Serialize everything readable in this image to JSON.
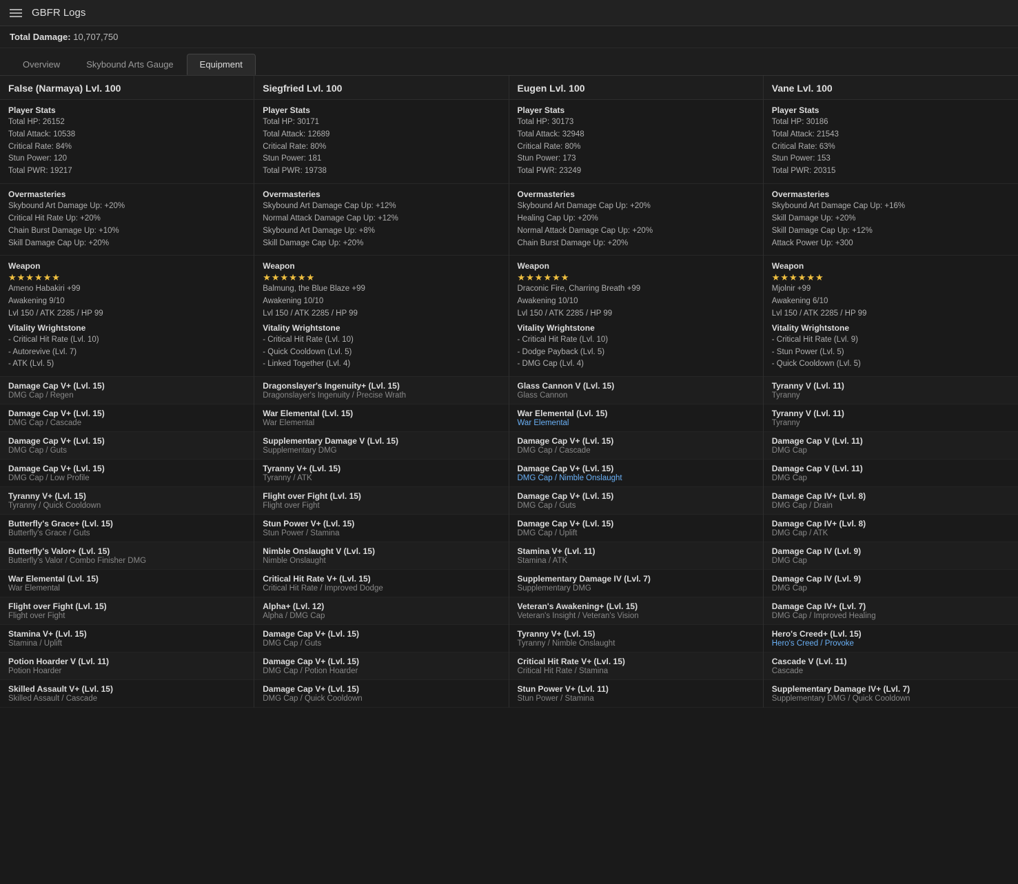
{
  "header": {
    "menu_icon_label": "Menu",
    "title": "GBFR Logs"
  },
  "total_damage": {
    "label": "Total Damage:",
    "value": "10,707,750"
  },
  "tabs": [
    {
      "label": "Overview",
      "active": false
    },
    {
      "label": "Skybound Arts Gauge",
      "active": false
    },
    {
      "label": "Equipment",
      "active": true
    }
  ],
  "columns": [
    {
      "header": "False (Narmaya) Lvl. 100",
      "player_stats": {
        "title": "Player Stats",
        "lines": [
          "Total HP: 26152",
          "Total Attack: 10538",
          "Critical Rate: 84%",
          "Stun Power: 120",
          "Total PWR: 19217"
        ]
      },
      "overmasteries": {
        "title": "Overmasteries",
        "lines": [
          "Skybound Art Damage Up: +20%",
          "Critical Hit Rate Up: +20%",
          "Chain Burst Damage Up: +10%",
          "Skill Damage Cap Up: +20%"
        ]
      },
      "weapon": {
        "title": "Weapon",
        "stars": "★★★★★★",
        "lines": [
          "Ameno Habakiri +99",
          "Awakening 9/10",
          "Lvl 150 / ATK 2285 / HP 99"
        ],
        "wrightstone_title": "Vitality Wrightstone",
        "wrightstone_lines": [
          "- Critical Hit Rate (Lvl. 10)",
          "- Autorevive (Lvl. 7)",
          "- ATK (Lvl. 5)"
        ]
      },
      "skills": [
        {
          "name": "Damage Cap V+ (Lvl. 15)",
          "sub": "DMG Cap / Regen",
          "highlight": false
        },
        {
          "name": "Damage Cap V+ (Lvl. 15)",
          "sub": "DMG Cap / Cascade",
          "highlight": false
        },
        {
          "name": "Damage Cap V+ (Lvl. 15)",
          "sub": "DMG Cap / Guts",
          "highlight": false
        },
        {
          "name": "Damage Cap V+ (Lvl. 15)",
          "sub": "DMG Cap / Low Profile",
          "highlight": false
        },
        {
          "name": "Tyranny V+ (Lvl. 15)",
          "sub": "Tyranny / Quick Cooldown",
          "highlight": false
        },
        {
          "name": "Butterfly's Grace+ (Lvl. 15)",
          "sub": "Butterfly's Grace / Guts",
          "highlight": false
        },
        {
          "name": "Butterfly's Valor+ (Lvl. 15)",
          "sub": "Butterfly's Valor / Combo Finisher DMG",
          "highlight": false
        },
        {
          "name": "War Elemental (Lvl. 15)",
          "sub": "War Elemental",
          "highlight": false
        },
        {
          "name": "Flight over Fight (Lvl. 15)",
          "sub": "Flight over Fight",
          "highlight": false
        },
        {
          "name": "Stamina V+ (Lvl. 15)",
          "sub": "Stamina / Uplift",
          "highlight": false
        },
        {
          "name": "Potion Hoarder V (Lvl. 11)",
          "sub": "Potion Hoarder",
          "highlight": false
        },
        {
          "name": "Skilled Assault V+ (Lvl. 15)",
          "sub": "Skilled Assault / Cascade",
          "highlight": false
        }
      ]
    },
    {
      "header": "Siegfried Lvl. 100",
      "player_stats": {
        "title": "Player Stats",
        "lines": [
          "Total HP: 30171",
          "Total Attack: 12689",
          "Critical Rate: 80%",
          "Stun Power: 181",
          "Total PWR: 19738"
        ]
      },
      "overmasteries": {
        "title": "Overmasteries",
        "lines": [
          "Skybound Art Damage Cap Up: +12%",
          "Normal Attack Damage Cap Up: +12%",
          "Skybound Art Damage Up: +8%",
          "Skill Damage Cap Up: +20%"
        ]
      },
      "weapon": {
        "title": "Weapon",
        "stars": "★★★★★★",
        "lines": [
          "Balmung, the Blue Blaze +99",
          "Awakening 10/10",
          "Lvl 150 / ATK 2285 / HP 99"
        ],
        "wrightstone_title": "Vitality Wrightstone",
        "wrightstone_lines": [
          "- Critical Hit Rate (Lvl. 10)",
          "- Quick Cooldown (Lvl. 5)",
          "- Linked Together (Lvl. 4)"
        ]
      },
      "skills": [
        {
          "name": "Dragonslayer's Ingenuity+ (Lvl. 15)",
          "sub": "Dragonslayer's Ingenuity / Precise Wrath",
          "highlight": false
        },
        {
          "name": "War Elemental (Lvl. 15)",
          "sub": "War Elemental",
          "highlight": false
        },
        {
          "name": "Supplementary Damage V (Lvl. 15)",
          "sub": "Supplementary DMG",
          "highlight": false
        },
        {
          "name": "Tyranny V+ (Lvl. 15)",
          "sub": "Tyranny / ATK",
          "highlight": false
        },
        {
          "name": "Flight over Fight (Lvl. 15)",
          "sub": "Flight over Fight",
          "highlight": false
        },
        {
          "name": "Stun Power V+ (Lvl. 15)",
          "sub": "Stun Power / Stamina",
          "highlight": false
        },
        {
          "name": "Nimble Onslaught V (Lvl. 15)",
          "sub": "Nimble Onslaught",
          "highlight": false
        },
        {
          "name": "Critical Hit Rate V+ (Lvl. 15)",
          "sub": "Critical Hit Rate / Improved Dodge",
          "highlight": false
        },
        {
          "name": "Alpha+ (Lvl. 12)",
          "sub": "Alpha / DMG Cap",
          "highlight": false
        },
        {
          "name": "Damage Cap V+ (Lvl. 15)",
          "sub": "DMG Cap / Guts",
          "highlight": false
        },
        {
          "name": "Damage Cap V+ (Lvl. 15)",
          "sub": "DMG Cap / Potion Hoarder",
          "highlight": false
        },
        {
          "name": "Damage Cap V+ (Lvl. 15)",
          "sub": "DMG Cap / Quick Cooldown",
          "highlight": false
        }
      ]
    },
    {
      "header": "Eugen Lvl. 100",
      "player_stats": {
        "title": "Player Stats",
        "lines": [
          "Total HP: 30173",
          "Total Attack: 32948",
          "Critical Rate: 80%",
          "Stun Power: 173",
          "Total PWR: 23249"
        ]
      },
      "overmasteries": {
        "title": "Overmasteries",
        "lines": [
          "Skybound Art Damage Cap Up: +20%",
          "Healing Cap Up: +20%",
          "Normal Attack Damage Cap Up: +20%",
          "Chain Burst Damage Up: +20%"
        ]
      },
      "weapon": {
        "title": "Weapon",
        "stars": "★★★★★★",
        "lines": [
          "Draconic Fire, Charring Breath +99",
          "Awakening 10/10",
          "Lvl 150 / ATK 2285 / HP 99"
        ],
        "wrightstone_title": "Vitality Wrightstone",
        "wrightstone_lines": [
          "- Critical Hit Rate (Lvl. 10)",
          "- Dodge Payback (Lvl. 5)",
          "- DMG Cap (Lvl. 4)"
        ]
      },
      "skills": [
        {
          "name": "Glass Cannon V (Lvl. 15)",
          "sub": "Glass Cannon",
          "highlight": false
        },
        {
          "name": "War Elemental (Lvl. 15)",
          "sub": "War Elemental",
          "highlight": true
        },
        {
          "name": "Damage Cap V+ (Lvl. 15)",
          "sub": "DMG Cap / Cascade",
          "highlight": false
        },
        {
          "name": "Damage Cap V+ (Lvl. 15)",
          "sub": "DMG Cap / Nimble Onslaught",
          "highlight": true
        },
        {
          "name": "Damage Cap V+ (Lvl. 15)",
          "sub": "DMG Cap / Guts",
          "highlight": false
        },
        {
          "name": "Damage Cap V+ (Lvl. 15)",
          "sub": "DMG Cap / Uplift",
          "highlight": false
        },
        {
          "name": "Stamina V+ (Lvl. 11)",
          "sub": "Stamina / ATK",
          "highlight": false
        },
        {
          "name": "Supplementary Damage IV (Lvl. 7)",
          "sub": "Supplementary DMG",
          "highlight": false
        },
        {
          "name": "Veteran's Awakening+ (Lvl. 15)",
          "sub": "Veteran's Insight / Veteran's Vision",
          "highlight": false
        },
        {
          "name": "Tyranny V+ (Lvl. 15)",
          "sub": "Tyranny / Nimble Onslaught",
          "highlight": false
        },
        {
          "name": "Critical Hit Rate V+ (Lvl. 15)",
          "sub": "Critical Hit Rate / Stamina",
          "highlight": false
        },
        {
          "name": "Stun Power V+ (Lvl. 11)",
          "sub": "Stun Power / Stamina",
          "highlight": false
        }
      ]
    },
    {
      "header": "Vane Lvl. 100",
      "player_stats": {
        "title": "Player Stats",
        "lines": [
          "Total HP: 30186",
          "Total Attack: 21543",
          "Critical Rate: 63%",
          "Stun Power: 153",
          "Total PWR: 20315"
        ]
      },
      "overmasteries": {
        "title": "Overmasteries",
        "lines": [
          "Skybound Art Damage Cap Up: +16%",
          "Skill Damage Up: +20%",
          "Skill Damage Cap Up: +12%",
          "Attack Power Up: +300"
        ]
      },
      "weapon": {
        "title": "Weapon",
        "stars": "★★★★★★",
        "lines": [
          "Mjolnir +99",
          "Awakening 6/10",
          "Lvl 150 / ATK 2285 / HP 99"
        ],
        "wrightstone_title": "Vitality Wrightstone",
        "wrightstone_lines": [
          "- Critical Hit Rate (Lvl. 9)",
          "- Stun Power (Lvl. 5)",
          "- Quick Cooldown (Lvl. 5)"
        ]
      },
      "skills": [
        {
          "name": "Tyranny V (Lvl. 11)",
          "sub": "Tyranny",
          "highlight": false
        },
        {
          "name": "Tyranny V (Lvl. 11)",
          "sub": "Tyranny",
          "highlight": false
        },
        {
          "name": "Damage Cap V (Lvl. 11)",
          "sub": "DMG Cap",
          "highlight": false
        },
        {
          "name": "Damage Cap V (Lvl. 11)",
          "sub": "DMG Cap",
          "highlight": false
        },
        {
          "name": "Damage Cap IV+ (Lvl. 8)",
          "sub": "DMG Cap / Drain",
          "highlight": false
        },
        {
          "name": "Damage Cap IV+ (Lvl. 8)",
          "sub": "DMG Cap / ATK",
          "highlight": false
        },
        {
          "name": "Damage Cap IV (Lvl. 9)",
          "sub": "DMG Cap",
          "highlight": false
        },
        {
          "name": "Damage Cap IV (Lvl. 9)",
          "sub": "DMG Cap",
          "highlight": false
        },
        {
          "name": "Damage Cap IV+ (Lvl. 7)",
          "sub": "DMG Cap / Improved Healing",
          "highlight": false
        },
        {
          "name": "Hero's Creed+ (Lvl. 15)",
          "sub": "Hero's Creed / Provoke",
          "highlight": true
        },
        {
          "name": "Cascade V (Lvl. 11)",
          "sub": "Cascade",
          "highlight": false
        },
        {
          "name": "Supplementary Damage IV+ (Lvl. 7)",
          "sub": "Supplementary DMG / Quick Cooldown",
          "highlight": false
        }
      ]
    }
  ]
}
